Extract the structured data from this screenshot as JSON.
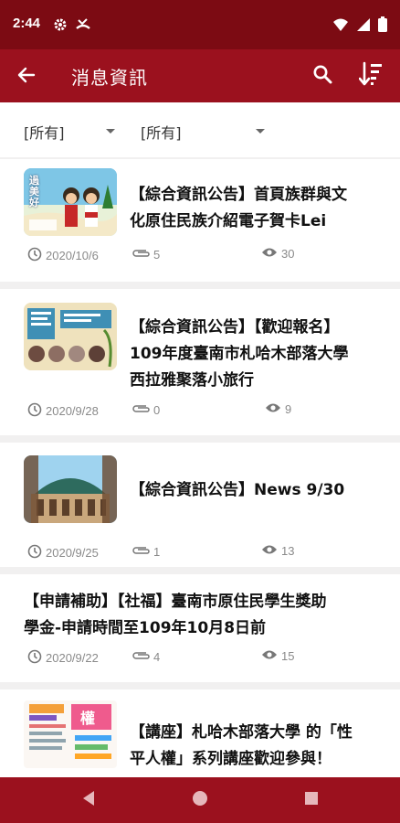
{
  "status_bar": {
    "time": "2:44",
    "left_icons": [
      "gear-icon",
      "missed-call-icon"
    ],
    "right_icons": [
      "wifi-icon",
      "signal-icon",
      "battery-icon"
    ]
  },
  "app_bar": {
    "title": "消息資訊",
    "back_icon": "arrow-left-icon",
    "search_icon": "search-icon",
    "sort_icon": "sort-icon"
  },
  "filters": [
    {
      "value": "[所有]"
    },
    {
      "value": "[所有]"
    }
  ],
  "news": [
    {
      "title_line1": "【綜合資訊公告】首頁族群與文",
      "title_line2": "化原住民族介紹電子賀卡Lei",
      "title_line3": "",
      "date": "2020/10/6",
      "attachments": "5",
      "views": "30",
      "thumbnail_text": "過 美 好"
    },
    {
      "title_line1": "【綜合資訊公告】【歡迎報名】",
      "title_line2": "109年度臺南市札哈木部落大學",
      "title_line3": "西拉雅聚落小旅行",
      "date": "2020/9/28",
      "attachments": "0",
      "views": "9"
    },
    {
      "title_line1": "【綜合資訊公告】News 9/30",
      "date": "2020/9/25",
      "attachments": "1",
      "views": "13"
    },
    {
      "title_line1": "【申請補助】【社福】臺南市原住民學生獎助",
      "title_line2": "學金-申請時間至109年10月8日前",
      "date": "2020/9/22",
      "attachments": "4",
      "views": "15"
    },
    {
      "title_line1": "【講座】札哈木部落大學 的「性",
      "title_line2": "平人權」系列講座歡迎參與！",
      "thumbnail_text": "權"
    }
  ],
  "nav_bar": {
    "back_icon": "nav-back-icon",
    "home_icon": "nav-home-icon",
    "recents_icon": "nav-recents-icon"
  },
  "colors": {
    "status_bar": "#7c0b13",
    "app_bar": "#9b111e",
    "nav_bar": "#9b111e",
    "background": "#f1f0f0",
    "meta_text": "#8a8a8a"
  }
}
